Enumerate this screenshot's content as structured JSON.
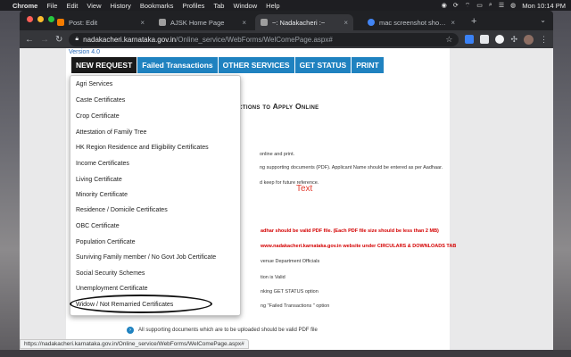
{
  "menubar": {
    "app_name": "Chrome",
    "items": [
      "File",
      "Edit",
      "View",
      "History",
      "Bookmarks",
      "Profiles",
      "Tab",
      "Window",
      "Help"
    ],
    "clock": "Mon 10:14 PM"
  },
  "tabs": [
    {
      "title": "Post: Edit",
      "favicon_color": "#f57c00"
    },
    {
      "title": "AJSK Home Page",
      "favicon_color": "#9e9e9e"
    },
    {
      "title": "~: Nadakacheri :~",
      "favicon_color": "#9e9e9e"
    },
    {
      "title": "mac screenshot shortcut - Goo",
      "favicon_color": "#4285f4"
    }
  ],
  "address": {
    "host": "nadakacheri.karnataka.gov.in",
    "path": "/Online_service/WebForms/WelComePage.aspx#"
  },
  "page": {
    "version": "Version 4.0",
    "nav": [
      "NEW REQUEST",
      "Failed Transactions",
      "OTHER SERVICES",
      "GET STATUS",
      "PRINT"
    ],
    "heading": "ructions to Apply Online",
    "lines": [
      "online and print.",
      "ng supporting documents (PDF). Applicant Name should be entered as per Aadhaar.",
      "d keep for future reference.",
      "adhar should be valid PDF file. (Each PDF file size should be less than 2 MB)",
      "www.nadakacheri.karnataka.gov.in website under CIRCULARS & DOWNLOADS TAB",
      "venue Department Officials",
      "tion is Valid",
      "nking GET STATUS option",
      "ng \"Failed Transactions \" option"
    ],
    "overlay_text": "Text",
    "bullet_text": "All supporting documents which are to be uploaded should be valid PDF file"
  },
  "dropdown": {
    "items": [
      "Agri Services",
      "Caste Certificates",
      "Crop Certificate",
      "Attestation of Family Tree",
      "HK Region Residence and Eligibility Certificates",
      "Income Certificates",
      "Living Certificate",
      "Minority Certificate",
      "Residence / Domicile Certificates",
      "OBC Certificate",
      "Population Certificate",
      "Surviving Family member / No Govt Job Certificate",
      "Social Security Schemes",
      "Unemployment Certificate",
      "Widow / Not Remarried Certificates"
    ],
    "highlighted_item": "Widow / Not Remarried Certificates"
  },
  "status_url": "https://nadakacheri.karnataka.gov.in/Online_service/WebForms/WelComePage.aspx#"
}
